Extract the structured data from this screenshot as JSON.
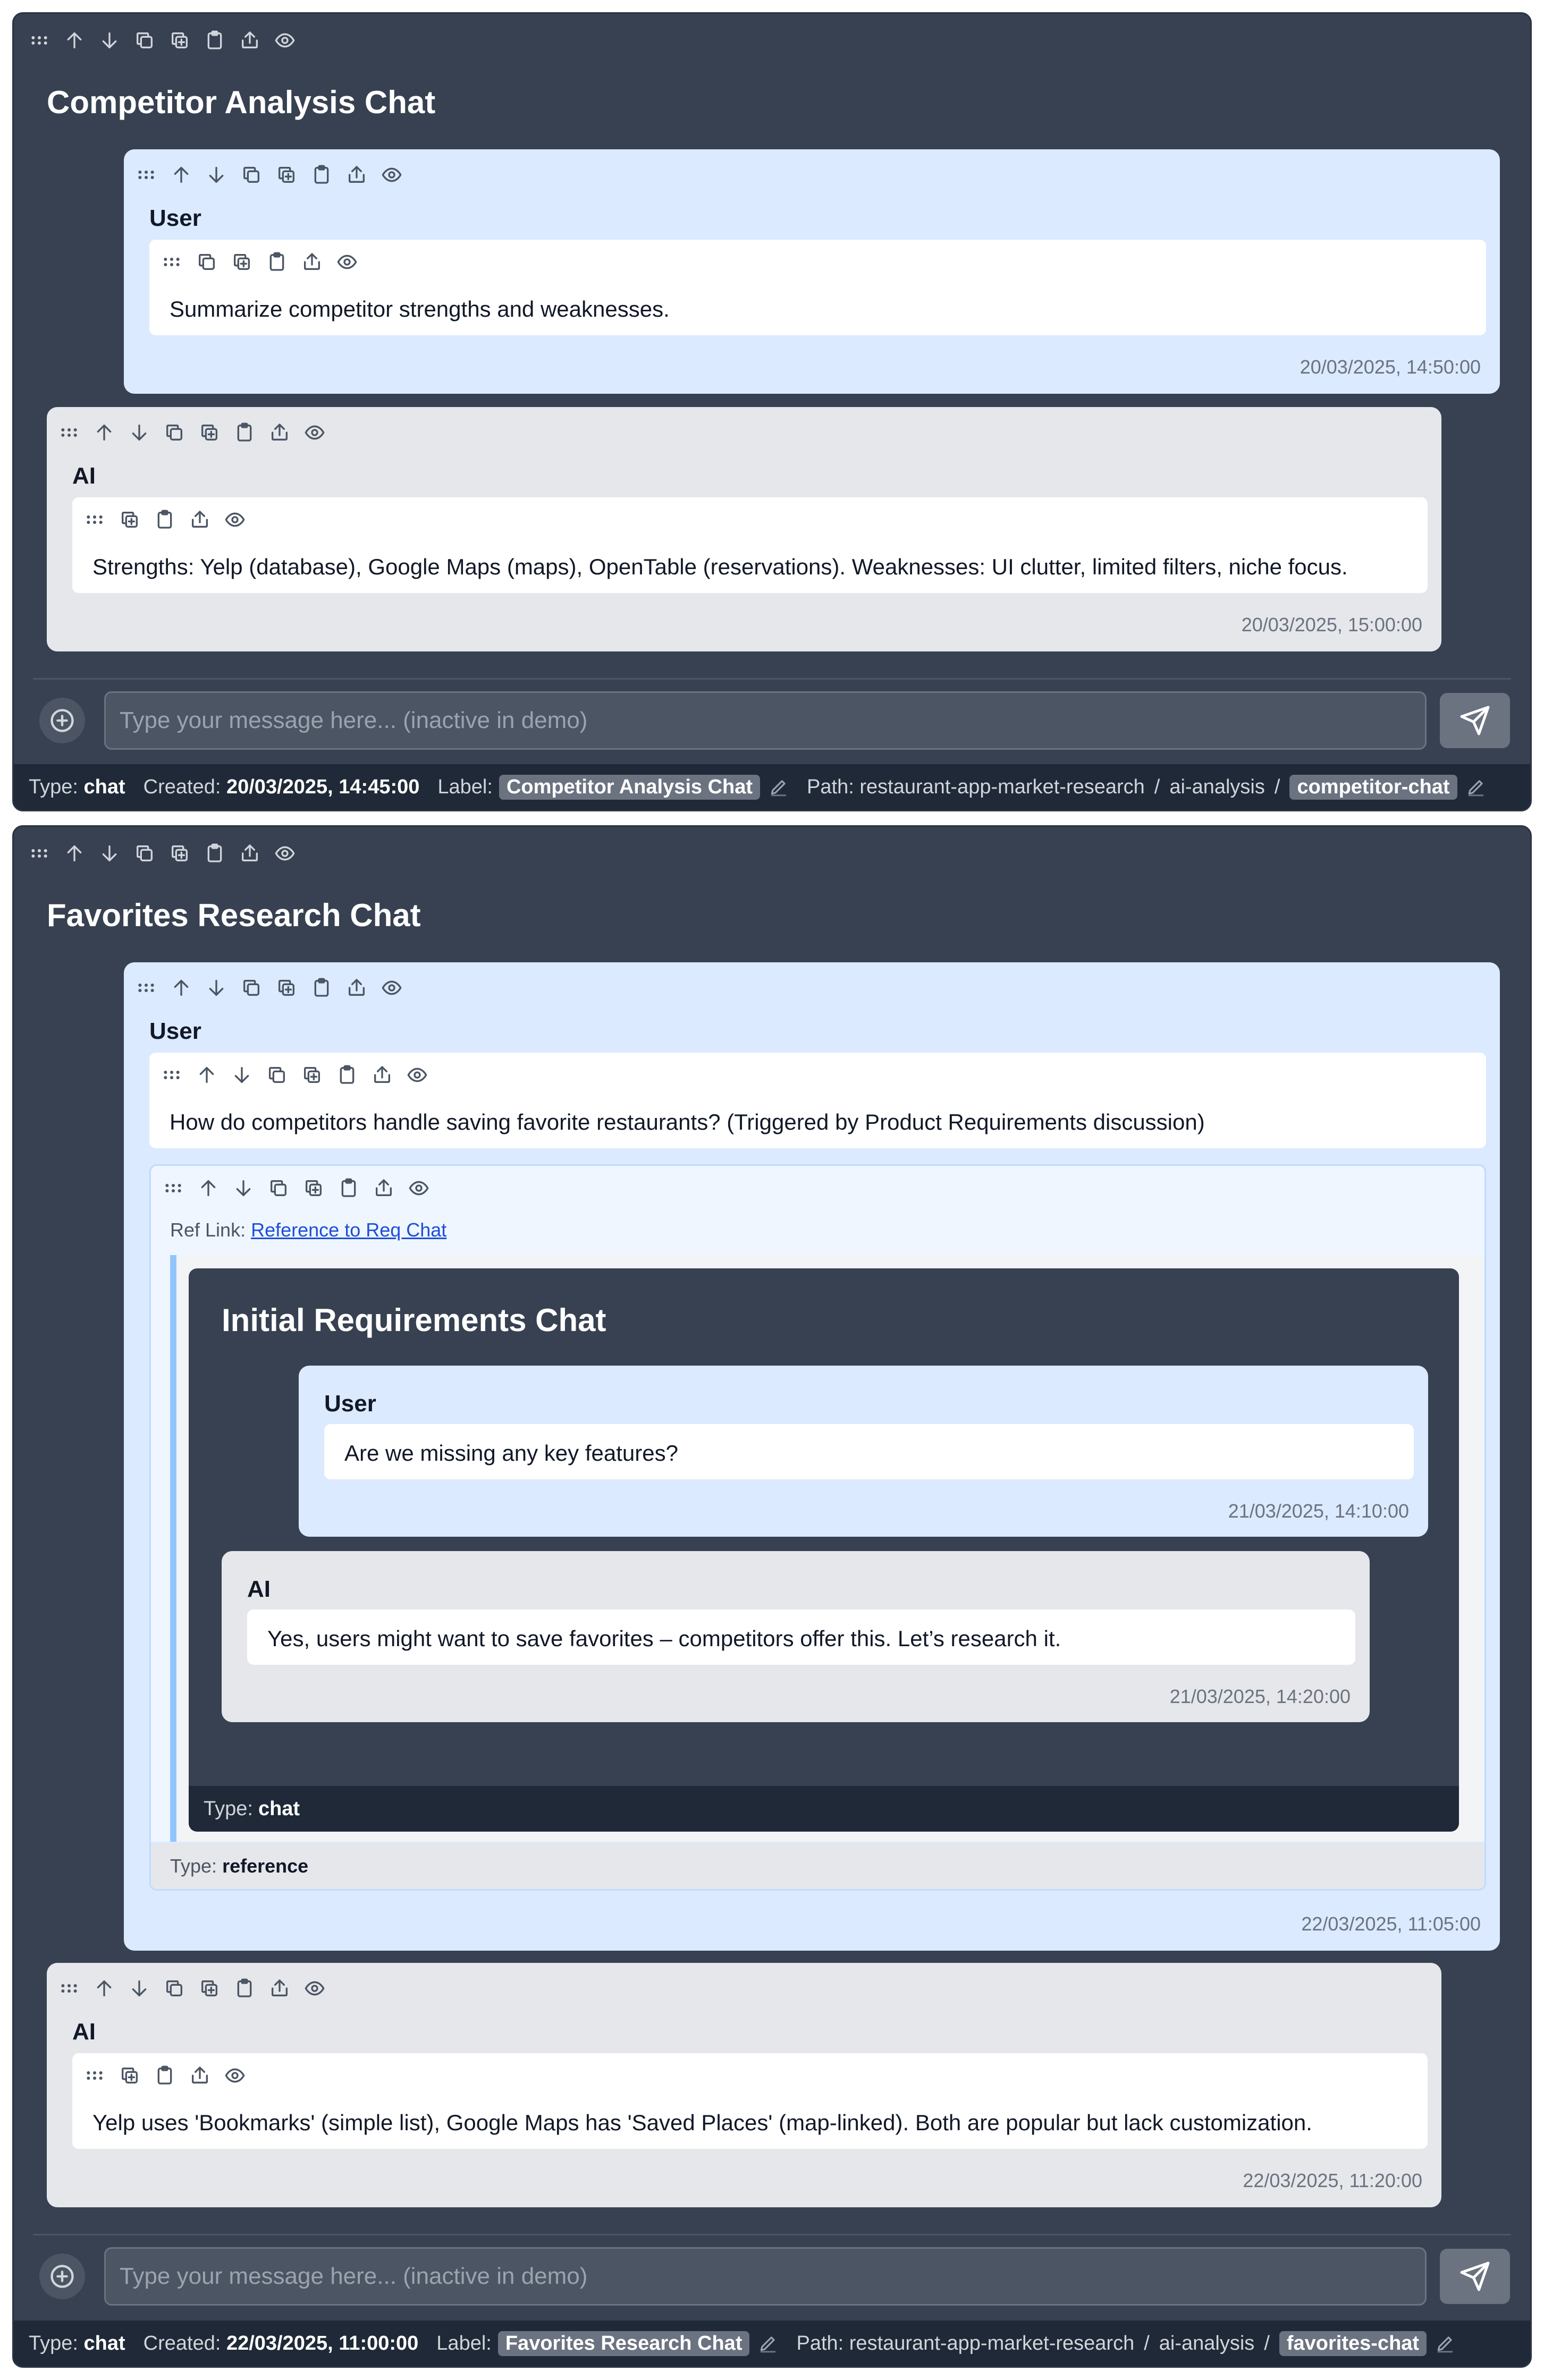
{
  "chats": [
    {
      "title": "Competitor Analysis Chat",
      "messages": [
        {
          "role": "User",
          "text": "Summarize competitor strengths and weaknesses.",
          "timestamp": "20/03/2025, 14:50:00"
        },
        {
          "role": "AI",
          "text": "Strengths: Yelp (database), Google Maps (maps), OpenTable (reservations). Weaknesses: UI clutter, limited filters, niche focus.",
          "timestamp": "20/03/2025, 15:00:00"
        }
      ],
      "input_placeholder": "Type your message here... (inactive in demo)",
      "footer": {
        "type_label": "Type:",
        "type_value": "chat",
        "created_label": "Created:",
        "created_value": "20/03/2025, 14:45:00",
        "label_label": "Label:",
        "label_value": "Competitor Analysis Chat",
        "path_label": "Path:",
        "path": [
          "restaurant-app-market-research",
          "ai-analysis"
        ],
        "path_leaf": "competitor-chat",
        "sep": "/"
      }
    },
    {
      "title": "Favorites Research Chat",
      "messages": [
        {
          "role": "User",
          "text": "How do competitors handle saving favorite restaurants? (Triggered by Product Requirements discussion)",
          "timestamp": "22/03/2025, 11:05:00"
        },
        {
          "role": "AI",
          "text": "Yelp uses 'Bookmarks' (simple list), Google Maps has 'Saved Places' (map-linked). Both are popular but lack customization.",
          "timestamp": "22/03/2025, 11:20:00"
        }
      ],
      "reference": {
        "label": "Ref Link:",
        "link_text": "Reference to Req Chat",
        "type_label": "Type:",
        "type_value": "reference",
        "embedded": {
          "title": "Initial Requirements Chat",
          "messages": [
            {
              "role": "User",
              "text": "Are we missing any key features?",
              "timestamp": "21/03/2025, 14:10:00"
            },
            {
              "role": "AI",
              "text": "Yes, users might want to save favorites – competitors offer this. Let’s research it.",
              "timestamp": "21/03/2025, 14:20:00"
            }
          ],
          "type_label": "Type:",
          "type_value": "chat"
        }
      },
      "input_placeholder": "Type your message here... (inactive in demo)",
      "footer": {
        "type_label": "Type:",
        "type_value": "chat",
        "created_label": "Created:",
        "created_value": "22/03/2025, 11:00:00",
        "label_label": "Label:",
        "label_value": "Favorites Research Chat",
        "path_label": "Path:",
        "path": [
          "restaurant-app-market-research",
          "ai-analysis"
        ],
        "path_leaf": "favorites-chat",
        "sep": "/"
      }
    }
  ],
  "icons": [
    "drag-handle-icon",
    "arrow-up-icon",
    "arrow-down-icon",
    "copy-icon",
    "duplicate-icon",
    "clipboard-icon",
    "share-icon",
    "eye-icon",
    "plus-circle-icon",
    "send-icon",
    "pencil-icon"
  ],
  "colors": {
    "panel": "#374151",
    "user_bubble": "#dbeafe",
    "ai_bubble": "#e5e7eb",
    "footer": "#1f2937",
    "link": "#1d4ed8",
    "ref_border": "#93c5fd"
  }
}
